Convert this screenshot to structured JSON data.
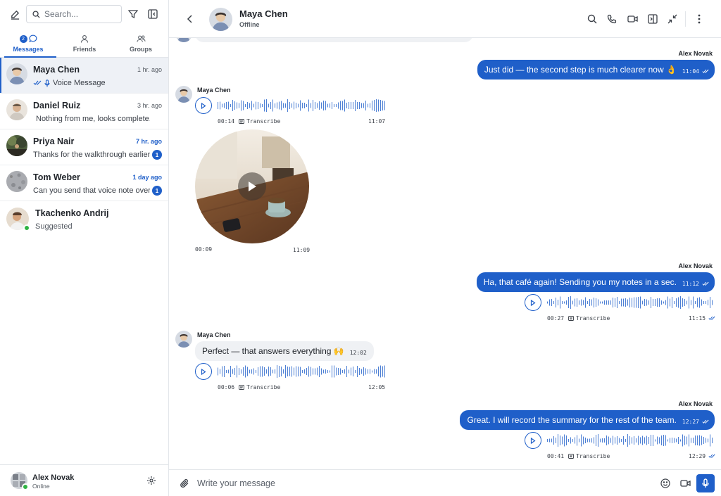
{
  "sidebar": {
    "search_placeholder": "Search...",
    "tabs": [
      {
        "label": "Messages",
        "badge": "2",
        "active": true
      },
      {
        "label": "Friends"
      },
      {
        "label": "Groups"
      }
    ],
    "conversations": [
      {
        "name": "Maya Chen",
        "time": "1 hr. ago",
        "preview": "Voice Message"
      },
      {
        "name": "Daniel Ruiz",
        "time": "3 hr. ago",
        "preview": "Nothing from me, looks complete."
      },
      {
        "name": "Priya Nair",
        "time": "7 hr. ago",
        "preview": "Thanks for the walkthrough earlier...",
        "unread": "1"
      },
      {
        "name": "Tom Weber",
        "time": "1 day ago",
        "preview": "Can you send that voice note over...",
        "unread": "1"
      },
      {
        "name": "Tkachenko Andrij",
        "preview": "Suggested"
      }
    ],
    "user": {
      "name": "Alex Novak",
      "status": "Online"
    }
  },
  "header": {
    "name": "Maya Chen",
    "status": "Offline"
  },
  "messages": {
    "m1": {
      "sender": "Alex Novak",
      "text": "Just did — the second step is much clearer now 👌",
      "time": "11:04"
    },
    "m2": {
      "sender": "Maya Chen",
      "duration": "00:14",
      "transcribe": "Transcribe",
      "time": "11:07"
    },
    "m3": {
      "duration": "00:09",
      "time": "11:09"
    },
    "m4": {
      "sender": "Alex Novak",
      "text": "Ha, that café again! Sending you my notes in a sec.",
      "time": "11:12",
      "duration": "00:27",
      "transcribe": "Transcribe",
      "voice_time": "11:15"
    },
    "m5": {
      "sender": "Maya Chen",
      "text": "Perfect — that answers everything 🙌",
      "time": "12:02",
      "duration": "00:06",
      "transcribe": "Transcribe",
      "voice_time": "12:05"
    },
    "m6": {
      "sender": "Alex Novak",
      "text": "Great. I will record the summary for the rest of the team.",
      "time": "12:27",
      "duration": "00:41",
      "transcribe": "Transcribe",
      "voice_time": "12:29"
    }
  },
  "composer": {
    "placeholder": "Write your message"
  },
  "colors": {
    "accent": "#1f5fc9",
    "online": "#2fb344",
    "incoming_bubble": "#eff1f4"
  }
}
